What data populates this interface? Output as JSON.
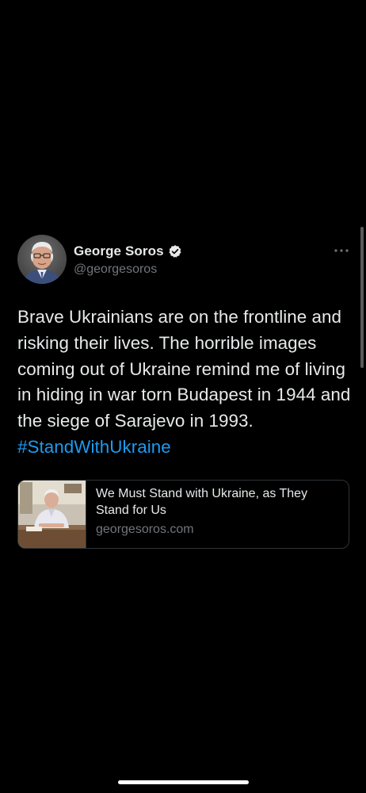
{
  "tweet": {
    "author": {
      "display_name": "George Soros",
      "handle": "@georgesoros",
      "verified": true
    },
    "text": "Brave Ukrainians are on the frontline and risking their lives. The horrible images coming out of Ukraine remind me of living in hiding in war torn Budapest in 1944 and the siege of Sarajevo in 1993. ",
    "hashtag": "#StandWithUkraine",
    "card": {
      "title": "We Must Stand with Ukraine, as They Stand for Us",
      "domain": "georgesoros.com"
    }
  },
  "icons": {
    "verified": "verified-badge-icon",
    "more": "more-options-icon"
  },
  "colors": {
    "background": "#000000",
    "text": "#e7e9ea",
    "secondary_text": "#71767b",
    "link": "#1d9bf0",
    "border": "#2f3336"
  }
}
